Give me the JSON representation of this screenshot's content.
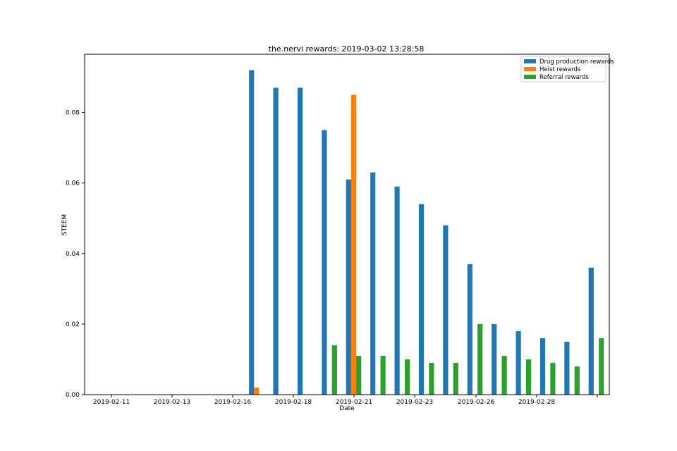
{
  "chart_data": {
    "type": "bar",
    "title": "the.nervi rewards: 2019-03-02 13:28:58",
    "xlabel": "Date",
    "ylabel": "STEEM",
    "ylim": [
      0,
      0.0965
    ],
    "yticks": [
      "0.00",
      "0.02",
      "0.04",
      "0.06",
      "0.08"
    ],
    "ytick_values": [
      0,
      0.02,
      0.04,
      0.06,
      0.08
    ],
    "xticks": [
      "2019-02-11",
      "2019-02-13",
      "2019-02-16",
      "2019-02-18",
      "2019-02-21",
      "2019-02-23",
      "2019-02-26",
      "2019-02-28",
      ""
    ],
    "grid": false,
    "legend_position": "top-right",
    "n_groups": 21,
    "series": [
      {
        "name": "Drug production rewards",
        "color": "#1f77b4",
        "values": [
          0,
          0,
          0,
          0,
          0,
          0,
          0.092,
          0.087,
          0.087,
          0.075,
          0.061,
          0.063,
          0.059,
          0.054,
          0.048,
          0.037,
          0.02,
          0.018,
          0.016,
          0.015,
          0.036
        ]
      },
      {
        "name": "Heist rewards",
        "color": "#ff7f0e",
        "values": [
          0,
          0,
          0,
          0,
          0,
          0,
          0.002,
          0,
          0,
          0,
          0.085,
          0,
          0,
          0,
          0,
          0,
          0,
          0,
          0,
          0,
          0
        ]
      },
      {
        "name": "Referral rewards",
        "color": "#2ca02c",
        "values": [
          0,
          0,
          0,
          0,
          0,
          0,
          0,
          0,
          0,
          0.014,
          0.011,
          0.011,
          0.01,
          0.009,
          0.009,
          0.02,
          0.011,
          0.01,
          0.009,
          0.008,
          0.016
        ]
      }
    ]
  }
}
